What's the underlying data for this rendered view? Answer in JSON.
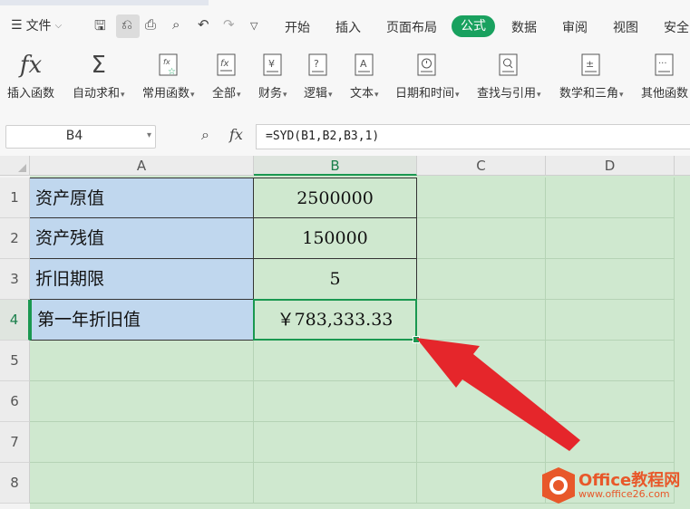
{
  "menu": {
    "file_label": "文件",
    "tabs": [
      "开始",
      "插入",
      "页面布局",
      "公式",
      "数据",
      "审阅",
      "视图",
      "安全"
    ],
    "active_tab": "公式"
  },
  "ribbon": {
    "insert_function": "插入函数",
    "autosum": "自动求和",
    "common": "常用函数",
    "all": "全部",
    "finance": "财务",
    "logic": "逻辑",
    "text": "文本",
    "datetime": "日期和时间",
    "lookup": "查找与引用",
    "math": "数学和三角",
    "other": "其他函数"
  },
  "formula_bar": {
    "name_box": "B4",
    "fx_label": "fx",
    "formula": "=SYD(B1,B2,B3,1)"
  },
  "columns": [
    "A",
    "B",
    "C",
    "D"
  ],
  "rows": [
    "1",
    "2",
    "3",
    "4",
    "5",
    "6",
    "7",
    "8"
  ],
  "cells": {
    "a1": "资产原值",
    "b1": "2500000",
    "a2": "资产残值",
    "b2": "150000",
    "a3": "折旧期限",
    "b3": "5",
    "a4": "第一年折旧值",
    "b4": "￥783,333.33"
  },
  "watermark": {
    "line1": "Office教程网",
    "line2": "www.office26.com"
  },
  "colors": {
    "accent": "#19a15f",
    "arrow": "#e5262b",
    "label_fill": "#c0d7ee",
    "sheet_fill": "#cfe8cf"
  }
}
